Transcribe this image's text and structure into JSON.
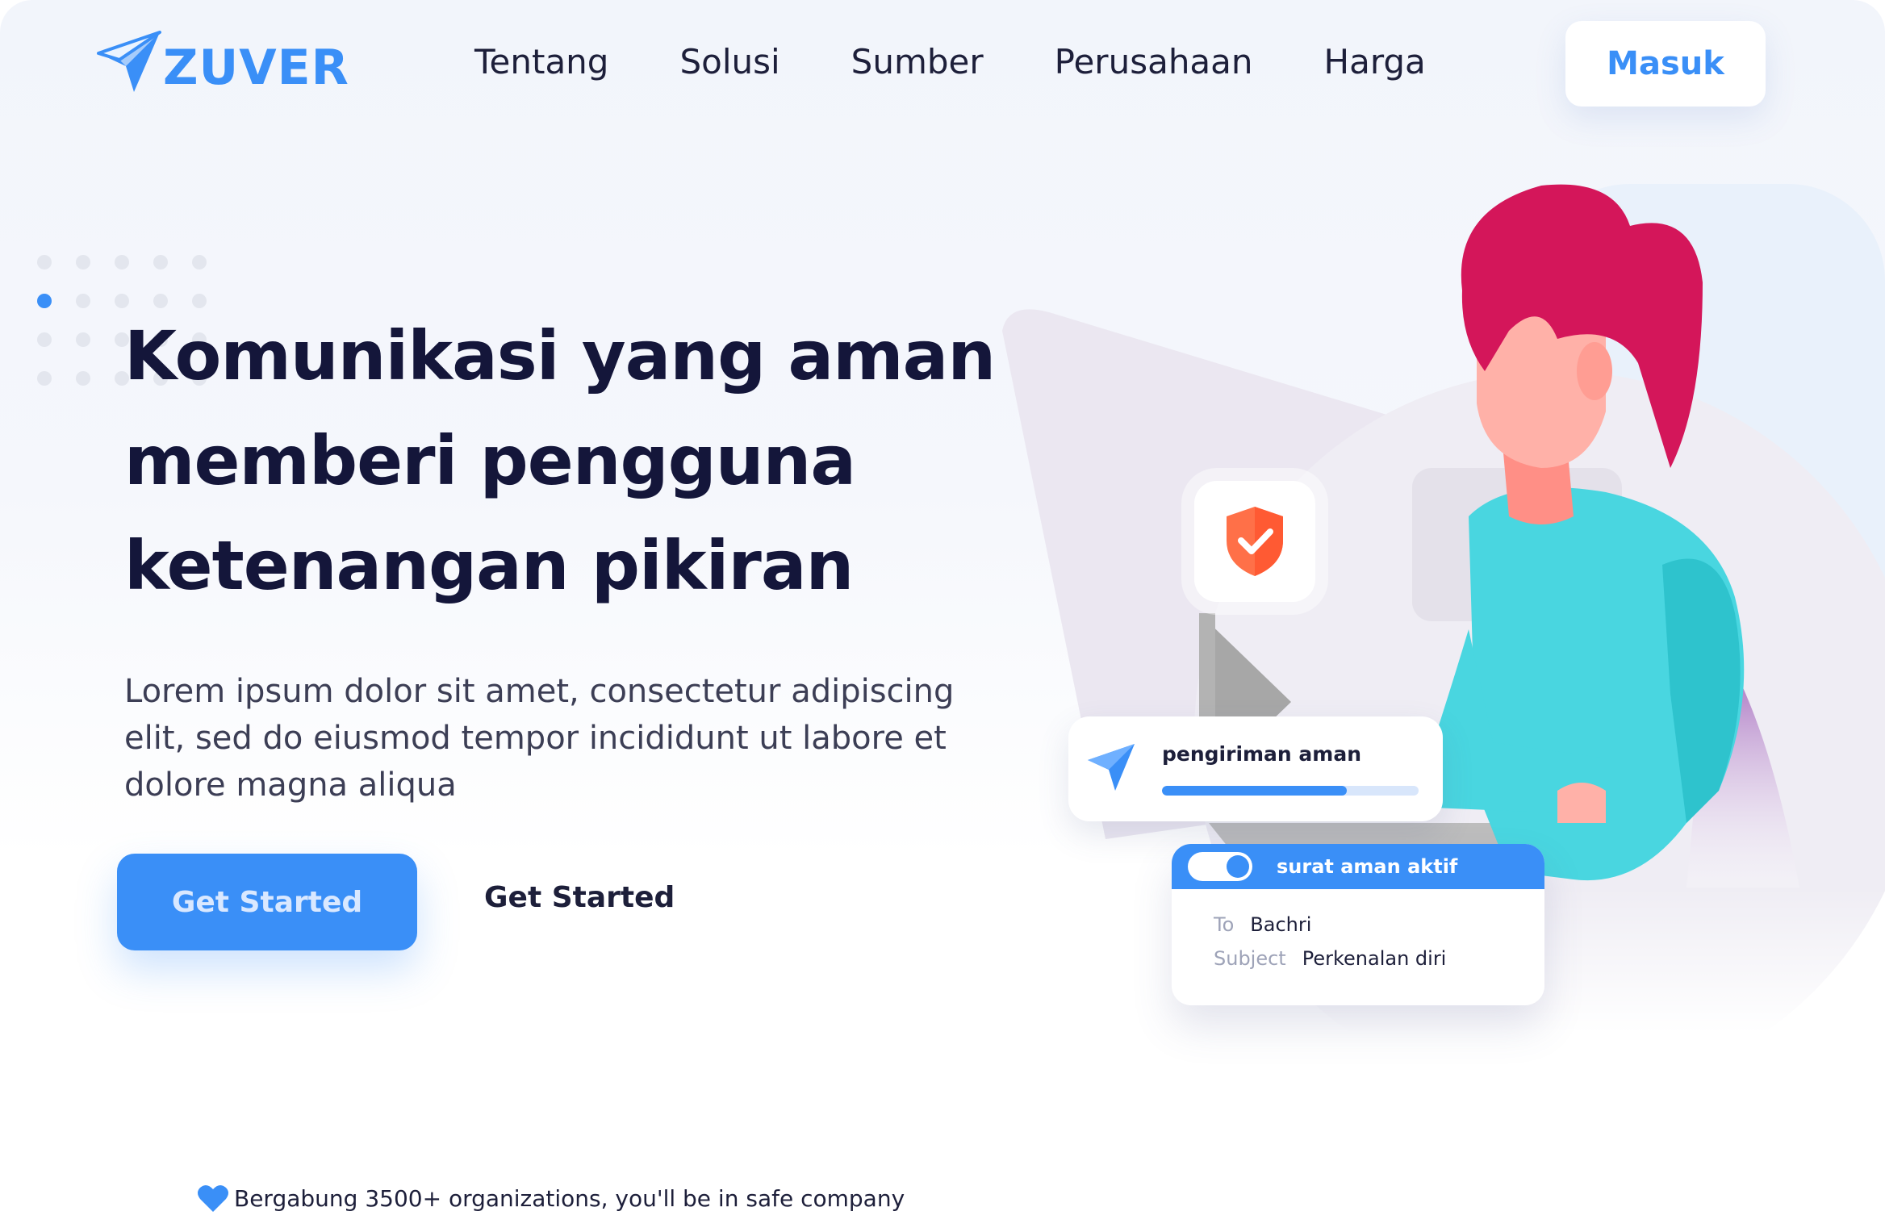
{
  "brand": {
    "name": "ZUVER",
    "accent": "#3a8ff7"
  },
  "nav": {
    "items": [
      {
        "label": "Tentang"
      },
      {
        "label": "Solusi"
      },
      {
        "label": "Sumber"
      },
      {
        "label": "Perusahaan"
      },
      {
        "label": "Harga"
      }
    ],
    "login_label": "Masuk"
  },
  "hero": {
    "headline_lines": [
      "Komunikasi yang aman",
      "memberi pengguna",
      "ketenangan pikiran"
    ],
    "description_lines": [
      "Lorem ipsum dolor sit amet, consectetur adipiscing",
      "elit, sed do eiusmod tempor incididunt ut labore et",
      "dolore magna aliqua"
    ],
    "primary_cta": "Get Started",
    "secondary_cta": "Get Started",
    "carousel_active_dot": 1
  },
  "illustration": {
    "shield_icon": "shield-check-icon",
    "send_card": {
      "label": "pengiriman aman",
      "progress": 0.72
    },
    "mail_card": {
      "title": "surat aman aktif",
      "toggle_on": true,
      "to_label": "To",
      "to_value": "Bachri",
      "subject_label": "Subject",
      "subject_value": "Perkenalan diri"
    }
  },
  "footer_note": "Bergabung 3500+ organizations, you'll be in safe company"
}
